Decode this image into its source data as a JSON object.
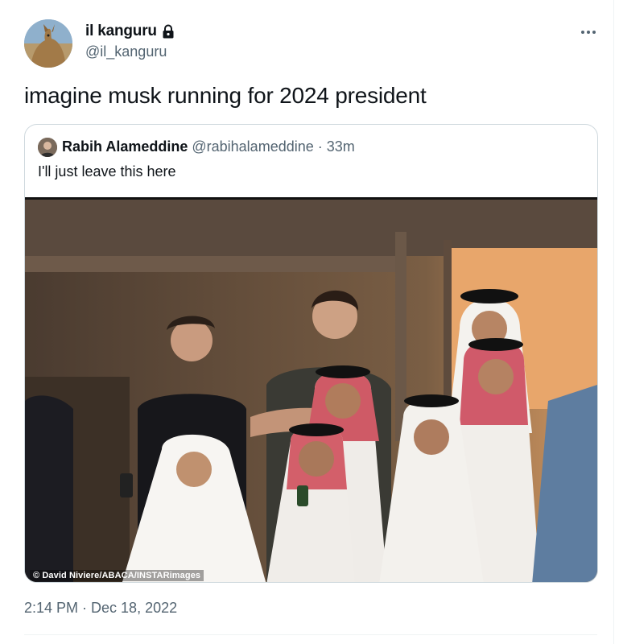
{
  "author": {
    "display_name": "il kanguru",
    "handle": "@il_kanguru",
    "protected": true
  },
  "tweet": {
    "text": "imagine musk running for 2024 president",
    "timestamp": "2:14 PM · Dec 18, 2022"
  },
  "quoted_tweet": {
    "display_name": "Rabih Alameddine",
    "handle": "@rabihalameddine",
    "age": "· 33m",
    "text": "I'll just leave this here",
    "media_credit": "© David Niviere/ABACA/INSTARimages"
  },
  "icons": {
    "lock": "lock-icon",
    "more": "more-options-icon"
  },
  "colors": {
    "text_primary": "#0f1419",
    "text_secondary": "#536471",
    "border": "#cfd9de"
  }
}
